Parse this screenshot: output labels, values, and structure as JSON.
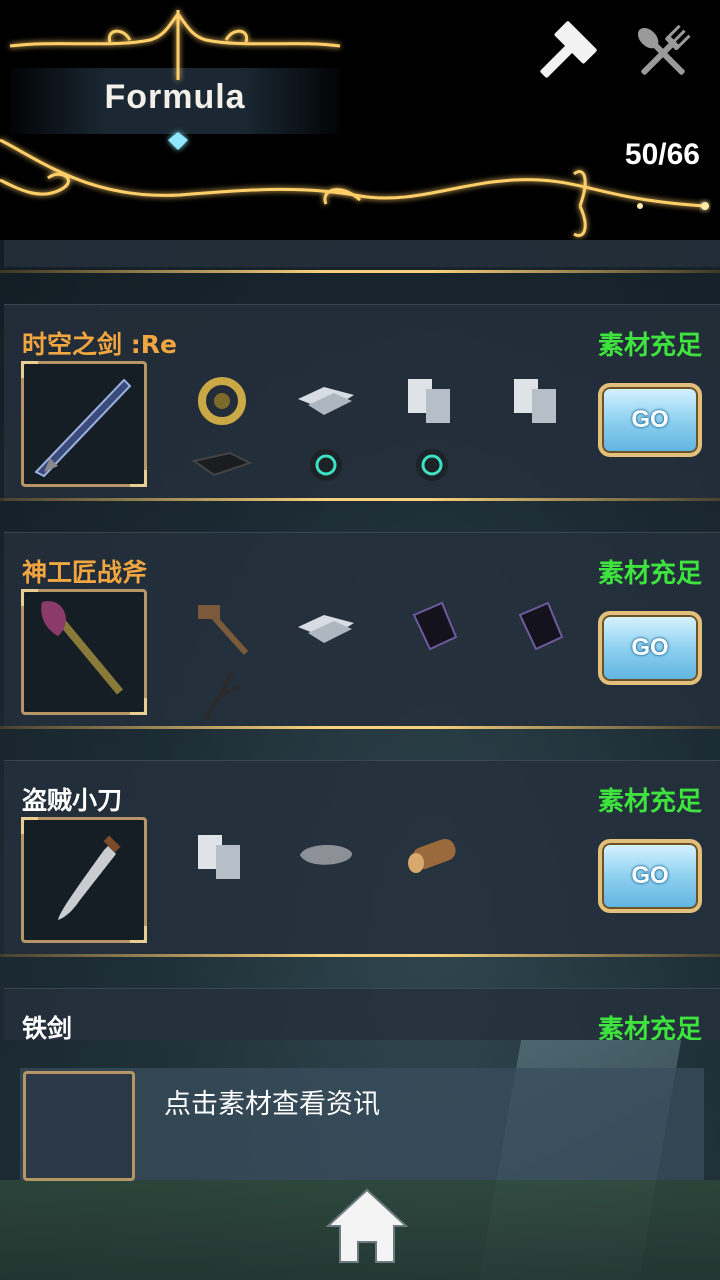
{
  "header": {
    "title": "Formula",
    "count": "50/66"
  },
  "toolbar": {
    "craft_icon": "hammer-icon",
    "cook_icon": "utensils-icon"
  },
  "recipes": [
    {
      "name": "时空之剑 :Re",
      "status": "素材充足",
      "go_label": "GO",
      "rarity": "rare",
      "materials": [
        "gear-ring",
        "silver-plate",
        "silver-plate",
        "silver-plate",
        "black-plate",
        "gem-clasp",
        "gem-clasp"
      ]
    },
    {
      "name": "神工匠战斧",
      "status": "素材充足",
      "go_label": "GO",
      "rarity": "rare",
      "materials": [
        "hammer",
        "silver-plate",
        "dark-crystal",
        "dark-crystal",
        "dark-branch"
      ]
    },
    {
      "name": "盗贼小刀",
      "status": "素材充足",
      "go_label": "GO",
      "rarity": "common",
      "materials": [
        "silver-plate",
        "stone",
        "wood-log"
      ]
    },
    {
      "name": "铁剑",
      "status": "素材充足",
      "rarity": "common"
    }
  ],
  "info": {
    "hint": "点击素材查看资讯"
  },
  "colors": {
    "accent_gold": "#f6d07a",
    "status_green": "#3ee33e",
    "rare_orange": "#f2a640"
  }
}
